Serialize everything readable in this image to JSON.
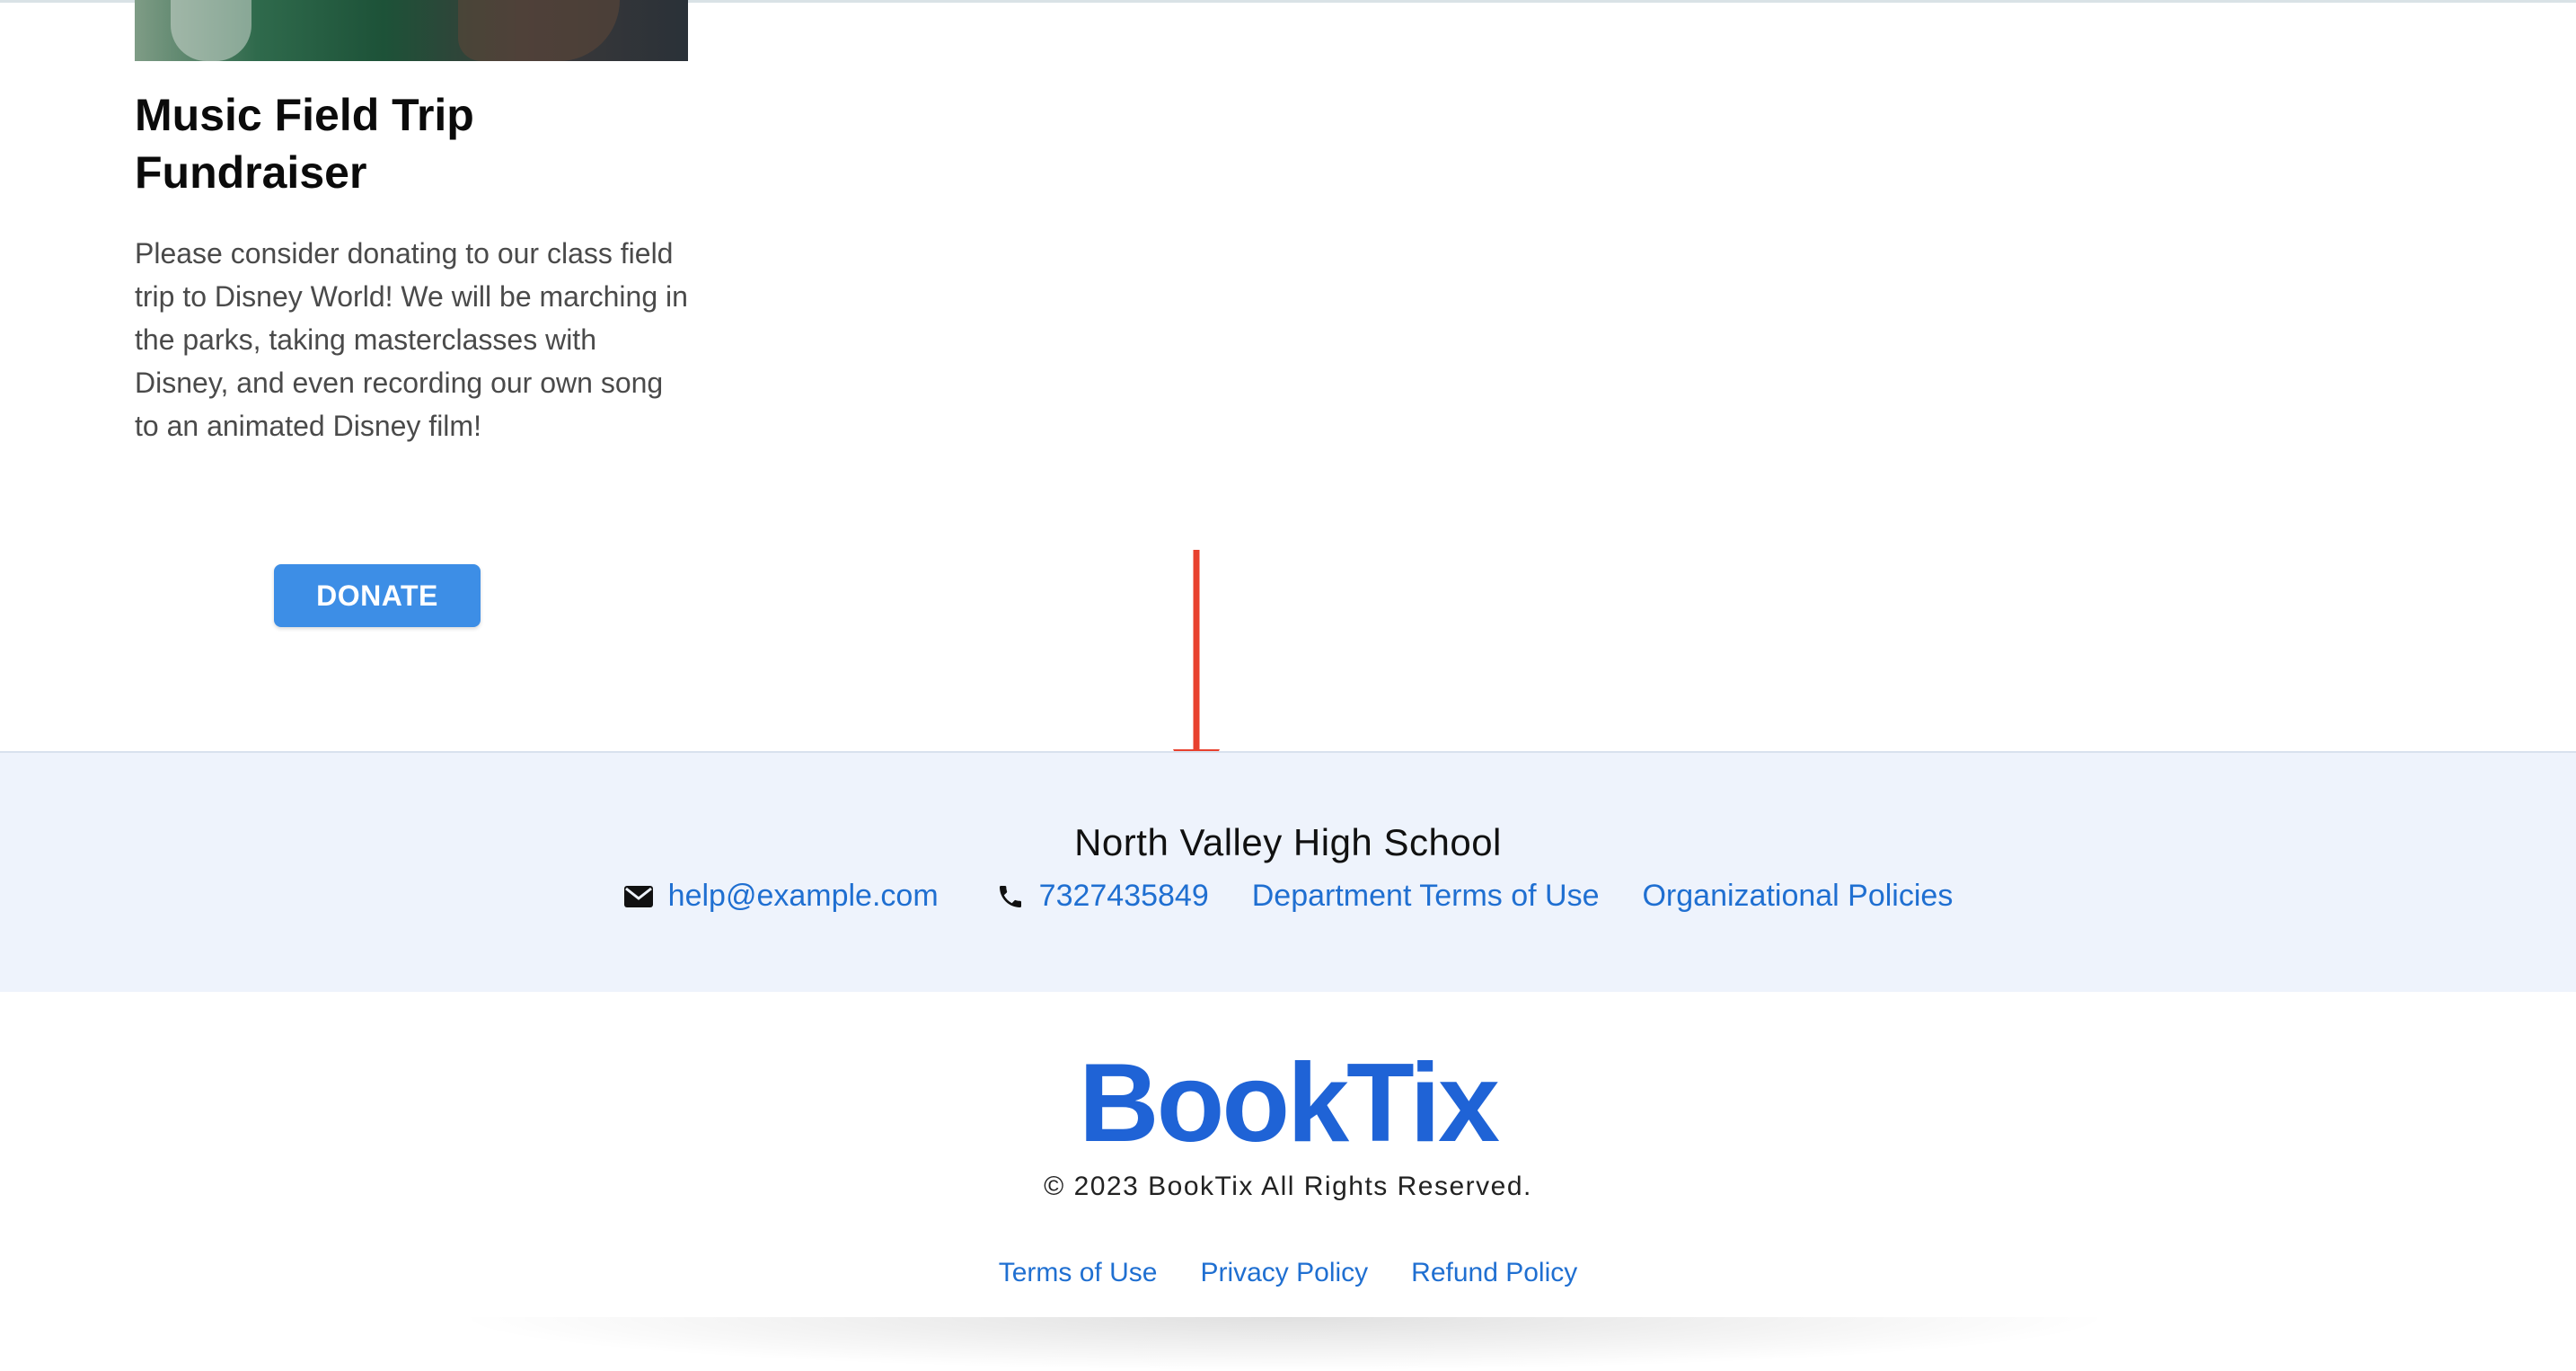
{
  "campaign": {
    "title": "Music Field Trip Fundraiser",
    "description": "Please consider donating to our class field trip to Disney World! We will be marching in the parks, taking masterclasses with Disney, and even recording our own song to an animated Disney film!",
    "donate_label": "DONATE"
  },
  "organization": {
    "name": "North Valley High School",
    "email": "help@example.com",
    "email_icon": "envelope-icon",
    "phone": "7327435849",
    "phone_icon": "phone-icon",
    "links": [
      "Department Terms of Use",
      "Organizational Policies"
    ]
  },
  "brand": {
    "logo_text": "BookTix",
    "copyright": "© 2023 BookTix All Rights Reserved.",
    "legal_links": [
      "Terms of Use",
      "Privacy Policy",
      "Refund Policy"
    ]
  },
  "colors": {
    "accent": "#1f63d6",
    "link": "#1f6fd1",
    "button": "#3d8ee6",
    "band_background": "#eef3fc",
    "annotation": "#e8412e"
  }
}
